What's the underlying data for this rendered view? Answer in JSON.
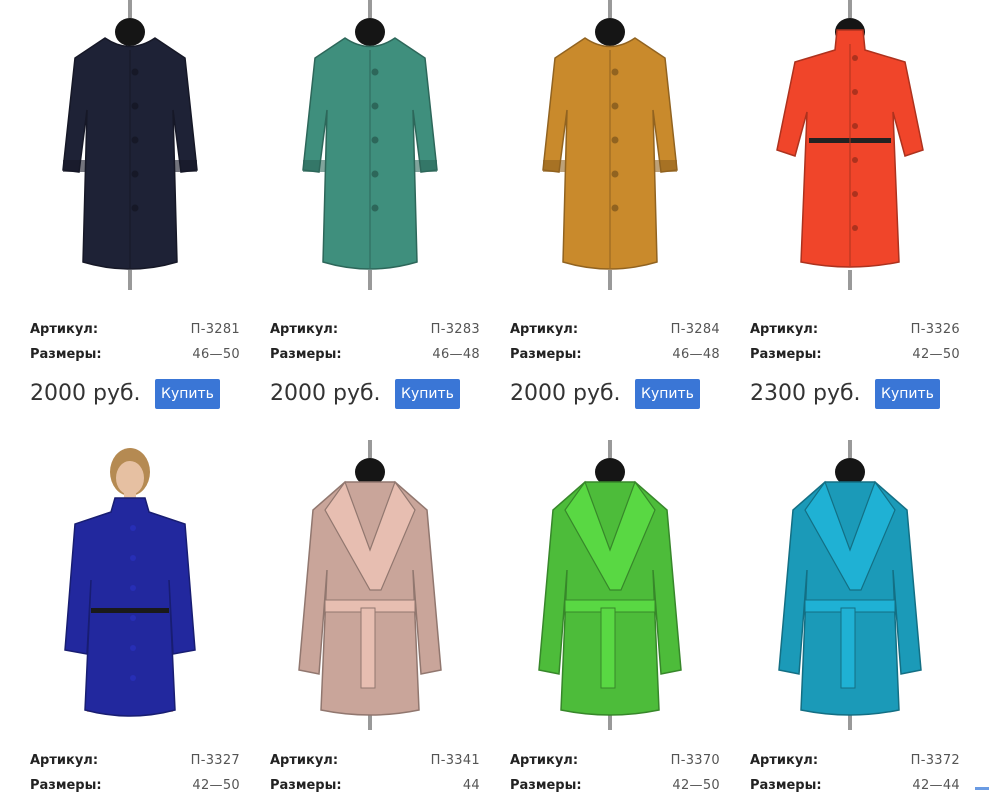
{
  "labels": {
    "article": "Артикул:",
    "sizes": "Размеры:"
  },
  "products": [
    {
      "article": "П-3281",
      "sizes": "46—50",
      "price": "2000 руб.",
      "buy": "Купить",
      "color": "#1e2236",
      "style": "round",
      "image": "coat-dark-navy"
    },
    {
      "article": "П-3283",
      "sizes": "46—48",
      "price": "2000 руб.",
      "buy": "Купить",
      "color": "#3f8f7d",
      "style": "round",
      "image": "coat-teal"
    },
    {
      "article": "П-3284",
      "sizes": "46—48",
      "price": "2000 руб.",
      "buy": "Купить",
      "color": "#c98a2c",
      "style": "round",
      "image": "coat-mustard"
    },
    {
      "article": "П-3326",
      "sizes": "42—50",
      "price": "2300 руб.",
      "buy": "Купить",
      "color": "#f0452a",
      "style": "belted",
      "image": "coat-red-belted"
    },
    {
      "article": "П-3327",
      "sizes": "42—50",
      "color": "#22289e",
      "style": "model",
      "image": "coat-royal-blue-model"
    },
    {
      "article": "П-3341",
      "sizes": "44",
      "color": "#c9a59a",
      "style": "wrap",
      "image": "coat-beige-wrap"
    },
    {
      "article": "П-3370",
      "sizes": "42—50",
      "color": "#4dbc3a",
      "style": "wrap",
      "image": "coat-green-wrap"
    },
    {
      "article": "П-3372",
      "sizes": "42—44",
      "color": "#1b9ab8",
      "style": "wrap",
      "image": "coat-turquoise-wrap"
    }
  ]
}
